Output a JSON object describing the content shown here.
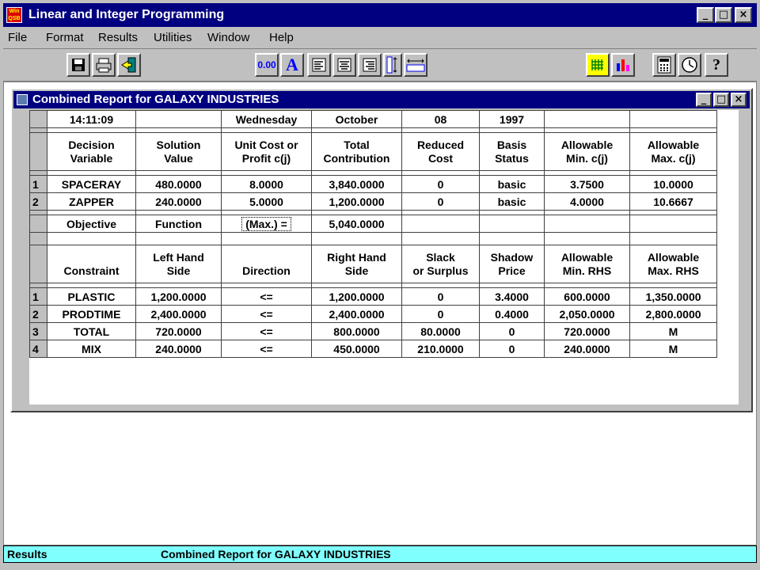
{
  "app": {
    "title": "Linear and Integer Programming",
    "icon_text": "Win QSB"
  },
  "window_buttons": {
    "minimize": "_",
    "maximize": "□",
    "close": "×"
  },
  "menu": [
    {
      "label": "File"
    },
    {
      "label": "Format"
    },
    {
      "label": "Results"
    },
    {
      "label": "Utilities"
    },
    {
      "label": "Window"
    },
    {
      "label": "Help"
    }
  ],
  "toolbar": {
    "decimal_label": "0.00",
    "font_label": "A",
    "icons": [
      "save-icon",
      "print-icon",
      "exit-icon",
      "decimal-icon",
      "font-icon",
      "align-left-icon",
      "align-center-icon",
      "align-right-icon",
      "row-height-icon",
      "column-width-icon",
      "grid-icon",
      "chart-icon",
      "calculator-icon",
      "clock-icon",
      "help-icon"
    ]
  },
  "child_window": {
    "title": "Combined Report for GALAXY INDUSTRIES"
  },
  "report": {
    "date_row": [
      "14:11:09",
      "",
      "Wednesday",
      "October",
      "08",
      "1997",
      "",
      ""
    ],
    "var_headers": [
      [
        "Decision",
        "Variable"
      ],
      [
        "Solution",
        "Value"
      ],
      [
        "Unit Cost or",
        "Profit c(j)"
      ],
      [
        "Total",
        "Contribution"
      ],
      [
        "Reduced",
        "Cost"
      ],
      [
        "Basis",
        "Status"
      ],
      [
        "Allowable",
        "Min. c(j)"
      ],
      [
        "Allowable",
        "Max. c(j)"
      ]
    ],
    "var_rows": [
      {
        "num": "1",
        "cells": [
          "SPACERAY",
          "480.0000",
          "8.0000",
          "3,840.0000",
          "0",
          "basic",
          "3.7500",
          "10.0000"
        ]
      },
      {
        "num": "2",
        "cells": [
          "ZAPPER",
          "240.0000",
          "5.0000",
          "1,200.0000",
          "0",
          "basic",
          "4.0000",
          "10.6667"
        ]
      }
    ],
    "objective_row": [
      "Objective",
      "Function",
      "(Max.) =",
      "5,040.0000",
      "",
      "",
      "",
      ""
    ],
    "con_headers": [
      [
        "",
        "Constraint"
      ],
      [
        "Left Hand",
        "Side"
      ],
      [
        "",
        "Direction"
      ],
      [
        "Right Hand",
        "Side"
      ],
      [
        "Slack",
        "or Surplus"
      ],
      [
        "Shadow",
        "Price"
      ],
      [
        "Allowable",
        "Min. RHS"
      ],
      [
        "Allowable",
        "Max. RHS"
      ]
    ],
    "con_rows": [
      {
        "num": "1",
        "cells": [
          "PLASTIC",
          "1,200.0000",
          "<=",
          "1,200.0000",
          "0",
          "3.4000",
          "600.0000",
          "1,350.0000"
        ]
      },
      {
        "num": "2",
        "cells": [
          "PRODTIME",
          "2,400.0000",
          "<=",
          "2,400.0000",
          "0",
          "0.4000",
          "2,050.0000",
          "2,800.0000"
        ]
      },
      {
        "num": "3",
        "cells": [
          "TOTAL",
          "720.0000",
          "<=",
          "800.0000",
          "80.0000",
          "0",
          "720.0000",
          "M"
        ]
      },
      {
        "num": "4",
        "cells": [
          "MIX",
          "240.0000",
          "<=",
          "450.0000",
          "210.0000",
          "0",
          "240.0000",
          "M"
        ]
      }
    ]
  },
  "status": {
    "left": "Results",
    "right": "Combined Report for GALAXY INDUSTRIES",
    "color": "#80ffff"
  }
}
